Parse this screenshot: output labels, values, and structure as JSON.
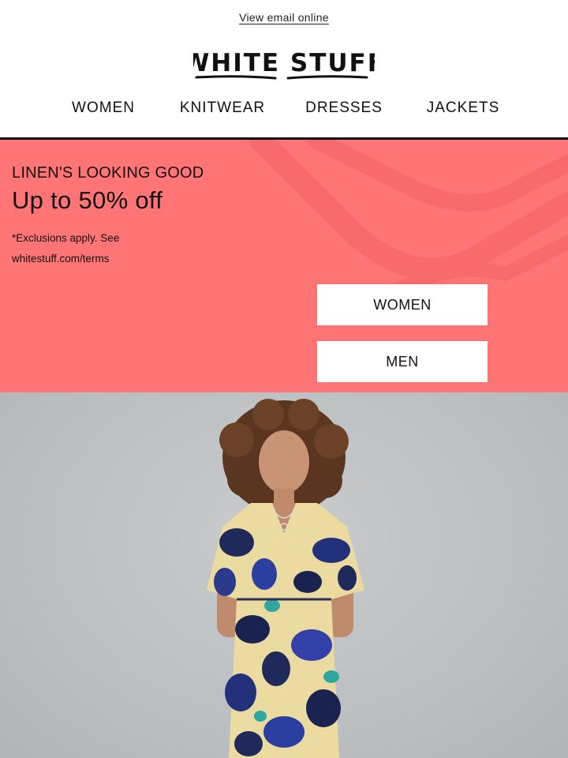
{
  "header": {
    "view_online": "View email online",
    "logo_text": "WHITE STUFF"
  },
  "nav": {
    "items": [
      "WOMEN",
      "KNITWEAR",
      "DRESSES",
      "JACKETS"
    ]
  },
  "hero": {
    "eyebrow": "LINEN'S LOOKING GOOD",
    "headline": "Up to 50% off",
    "fine_print_line1": "*Exclusions apply. See",
    "fine_print_line2": "whitestuff.com/terms",
    "button_women": "WOMEN",
    "button_men": "MEN",
    "background_color": "#ff7575"
  },
  "photo": {
    "subject": "model-in-floral-dress"
  }
}
